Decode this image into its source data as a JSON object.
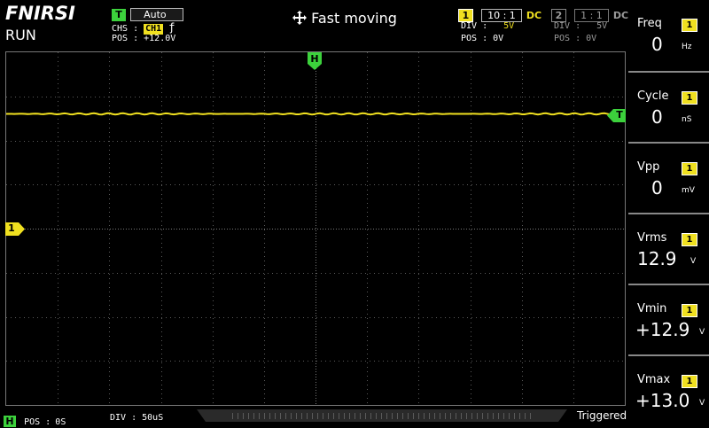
{
  "brand": "FNIRSI",
  "run_state": "RUN",
  "trigger": {
    "badge": "T",
    "mode": "Auto",
    "source_label": "CHS :",
    "source": "CH1",
    "edge": "ƒ",
    "pos_label": "POS :",
    "pos": "+12.0V"
  },
  "title": "Fast moving",
  "channels": [
    {
      "badge": "1",
      "probe": "10 : 1",
      "coupling": "DC",
      "div_label": "DIV :",
      "div": "5V",
      "pos_label": "POS :",
      "pos": "0V",
      "active": true
    },
    {
      "badge": "2",
      "probe": "1 : 1",
      "coupling": "DC",
      "div_label": "DIV :",
      "div": "5V",
      "pos_label": "POS :",
      "pos": "0V",
      "active": false
    }
  ],
  "markers": {
    "h_marker": "H",
    "trigger_marker": "T",
    "channel_marker": "1"
  },
  "measurements": [
    {
      "label": "Freq",
      "channel": "1",
      "value": "0",
      "unit": "Hz"
    },
    {
      "label": "Cycle",
      "channel": "1",
      "value": "0",
      "unit": "nS"
    },
    {
      "label": "Vpp",
      "channel": "1",
      "value": "0",
      "unit": "mV"
    },
    {
      "label": "Vrms",
      "channel": "1",
      "value": "12.9",
      "unit": "V"
    },
    {
      "label": "Vmin",
      "channel": "1",
      "value": "+12.9",
      "unit": "V"
    },
    {
      "label": "Vmax",
      "channel": "1",
      "value": "+13.0",
      "unit": "V"
    }
  ],
  "timebase": {
    "badge": "H",
    "pos_label": "POS :",
    "pos": "0S",
    "div_label": "DIV :",
    "div": "50uS"
  },
  "status": "Triggered",
  "colors": {
    "ch1": "#f0e020",
    "trigger": "#3cd13c",
    "grid": "#5a5a5a"
  }
}
